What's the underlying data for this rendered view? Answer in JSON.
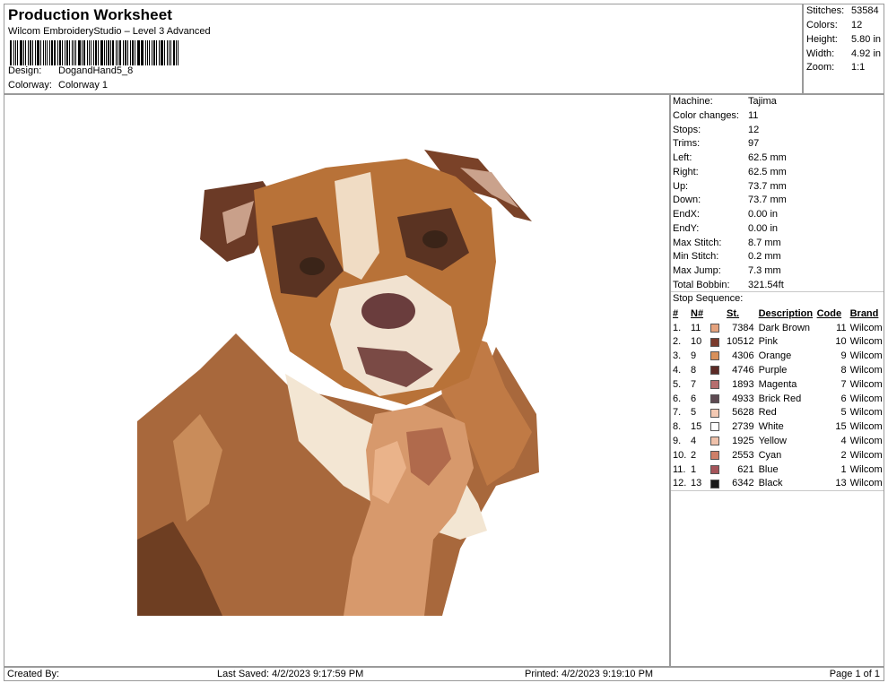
{
  "header": {
    "title": "Production Worksheet",
    "software": "Wilcom EmbroideryStudio – Level 3 Advanced",
    "design_label": "Design:",
    "design_value": "DogandHand5_8",
    "colorway_label": "Colorway:",
    "colorway_value": "Colorway 1"
  },
  "summary": {
    "stitches_label": "Stitches:",
    "stitches_value": "53584",
    "colors_label": "Colors:",
    "colors_value": "12",
    "height_label": "Height:",
    "height_value": "5.80 in",
    "width_label": "Width:",
    "width_value": "4.92 in",
    "zoom_label": "Zoom:",
    "zoom_value": "1:1"
  },
  "machine_info": [
    {
      "label": "Machine:",
      "value": "Tajima"
    },
    {
      "label": "Color changes:",
      "value": "11"
    },
    {
      "label": "Stops:",
      "value": "12"
    },
    {
      "label": "Trims:",
      "value": "97"
    },
    {
      "label": "Left:",
      "value": "62.5 mm"
    },
    {
      "label": "Right:",
      "value": "62.5 mm"
    },
    {
      "label": "Up:",
      "value": "73.7 mm"
    },
    {
      "label": "Down:",
      "value": "73.7 mm"
    },
    {
      "label": "EndX:",
      "value": "0.00 in"
    },
    {
      "label": "EndY:",
      "value": "0.00 in"
    },
    {
      "label": "Max Stitch:",
      "value": "8.7 mm"
    },
    {
      "label": "Min Stitch:",
      "value": "0.2 mm"
    },
    {
      "label": "Max Jump:",
      "value": "7.3 mm"
    },
    {
      "label": "Total Bobbin:",
      "value": "321.54ft"
    }
  ],
  "stop_sequence": {
    "title": "Stop Sequence:",
    "headers": {
      "num": "#",
      "n": "N#",
      "st": "St.",
      "desc": "Description",
      "code": "Code",
      "brand": "Brand"
    },
    "rows": [
      {
        "num": "1.",
        "n": "11",
        "color": "#e4a27d",
        "st": "7384",
        "desc": "Dark Brown",
        "code": "11",
        "brand": "Wilcom"
      },
      {
        "num": "2.",
        "n": "10",
        "color": "#7b3a2c",
        "st": "10512",
        "desc": "Pink",
        "code": "10",
        "brand": "Wilcom"
      },
      {
        "num": "3.",
        "n": "9",
        "color": "#d8905a",
        "st": "4306",
        "desc": "Orange",
        "code": "9",
        "brand": "Wilcom"
      },
      {
        "num": "4.",
        "n": "8",
        "color": "#5c2a26",
        "st": "4746",
        "desc": "Purple",
        "code": "8",
        "brand": "Wilcom"
      },
      {
        "num": "5.",
        "n": "7",
        "color": "#b66e6e",
        "st": "1893",
        "desc": "Magenta",
        "code": "7",
        "brand": "Wilcom"
      },
      {
        "num": "6.",
        "n": "6",
        "color": "#5e4a52",
        "st": "4933",
        "desc": "Brick Red",
        "code": "6",
        "brand": "Wilcom"
      },
      {
        "num": "7.",
        "n": "5",
        "color": "#f3c9b3",
        "st": "5628",
        "desc": "Red",
        "code": "5",
        "brand": "Wilcom"
      },
      {
        "num": "8.",
        "n": "15",
        "color": "#ffffff",
        "st": "2739",
        "desc": "White",
        "code": "15",
        "brand": "Wilcom"
      },
      {
        "num": "9.",
        "n": "4",
        "color": "#efc1aa",
        "st": "1925",
        "desc": "Yellow",
        "code": "4",
        "brand": "Wilcom"
      },
      {
        "num": "10.",
        "n": "2",
        "color": "#cf7f68",
        "st": "2553",
        "desc": "Cyan",
        "code": "2",
        "brand": "Wilcom"
      },
      {
        "num": "11.",
        "n": "1",
        "color": "#a5545a",
        "st": "621",
        "desc": "Blue",
        "code": "1",
        "brand": "Wilcom"
      },
      {
        "num": "12.",
        "n": "13",
        "color": "#1a1a1a",
        "st": "6342",
        "desc": "Black",
        "code": "13",
        "brand": "Wilcom"
      }
    ]
  },
  "footer": {
    "created_by": "Created By:",
    "last_saved": "Last Saved: 4/2/2023 9:17:59 PM",
    "printed": "Printed: 4/2/2023 9:19:10 PM",
    "page": "Page 1 of 1"
  }
}
